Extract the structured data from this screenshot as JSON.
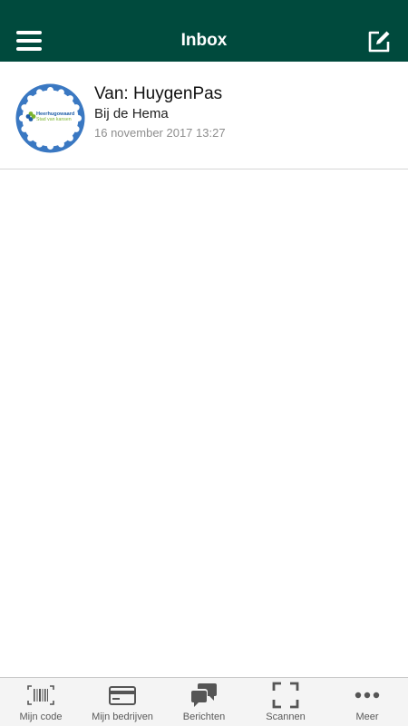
{
  "header": {
    "title": "Inbox",
    "background_color": "#004a3d",
    "menu_icon": "hamburger-menu-icon",
    "compose_icon": "compose-icon"
  },
  "messages": [
    {
      "from": "Van: HuygenPas",
      "subject": "Bij de Hema",
      "date": "16 november 2017 13:27",
      "avatar": {
        "logo_text_line1": "Heerhugowaard",
        "logo_text_line2": "Stad van kansen"
      }
    }
  ],
  "tabbar": {
    "items": [
      {
        "label": "Mijn code",
        "icon": "barcode-icon"
      },
      {
        "label": "Mijn bedrijven",
        "icon": "card-icon"
      },
      {
        "label": "Berichten",
        "icon": "chat-bubbles-icon"
      },
      {
        "label": "Scannen",
        "icon": "scan-frame-icon"
      },
      {
        "label": "Meer",
        "icon": "more-dots-icon"
      }
    ]
  },
  "colors": {
    "avatar_ring": "#3a78c2",
    "logo_green": "#7bb32e",
    "logo_blue": "#1f5ea8"
  }
}
